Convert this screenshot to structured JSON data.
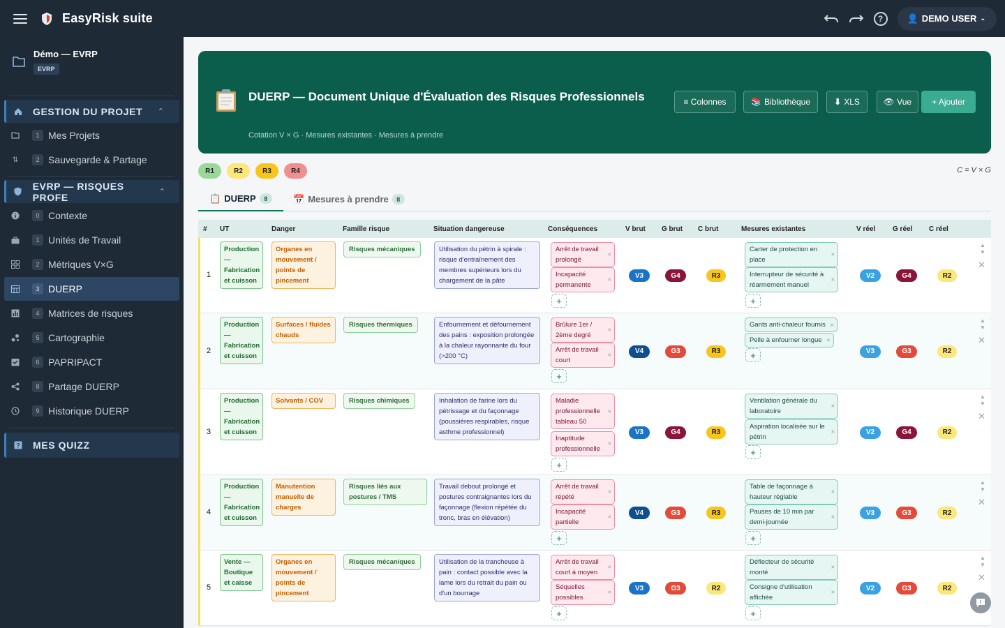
{
  "app": {
    "title": "EasyRisk suite",
    "user": "DEMO USER"
  },
  "sidebar": {
    "project_name": "Démo — EVRP",
    "project_badge": "EVRP",
    "group1": "GESTION DU PROJET",
    "group1_items": [
      {
        "num": "1",
        "label": "Mes Projets",
        "icon": "folder-icon"
      },
      {
        "num": "2",
        "label": "Sauvegarde & Partage",
        "icon": "sort-icon"
      }
    ],
    "group2": "EVRP — RISQUES PROFE",
    "group2_items": [
      {
        "num": "0",
        "label": "Contexte",
        "icon": "info-icon"
      },
      {
        "num": "1",
        "label": "Unités de Travail",
        "icon": "briefcase-icon"
      },
      {
        "num": "2",
        "label": "Métriques V×G",
        "icon": "grid-icon"
      },
      {
        "num": "3",
        "label": "DUERP",
        "icon": "table-icon",
        "active": true
      },
      {
        "num": "4",
        "label": "Matrices de risques",
        "icon": "chart-icon"
      },
      {
        "num": "5",
        "label": "Cartographie",
        "icon": "scatter-icon"
      },
      {
        "num": "6",
        "label": "PAPRIPACT",
        "icon": "checklist-icon"
      },
      {
        "num": "8",
        "label": "Partage DUERP",
        "icon": "share-icon"
      },
      {
        "num": "9",
        "label": "Historique DUERP",
        "icon": "history-icon"
      }
    ],
    "group3": "MES QUIZZ"
  },
  "hero": {
    "title": "DUERP — Document Unique d'Évaluation des Risques Professionnels",
    "subtitle": "Cotation V × G · Mesures existantes · Mesures à prendre",
    "buttons": {
      "columns": "≡ Colonnes",
      "library": "Bibliothèque",
      "xls": "XLS",
      "view": "Vue",
      "add": "+ Ajouter"
    }
  },
  "risk_chips": [
    {
      "label": "R1",
      "color": "#9ad89a"
    },
    {
      "label": "R2",
      "color": "#fbe77a"
    },
    {
      "label": "R3",
      "color": "#f8c61a"
    },
    {
      "label": "R4",
      "color": "#ef8f8f"
    }
  ],
  "formula": "C = V × G",
  "tabs": [
    {
      "label": "DUERP",
      "count": "8"
    },
    {
      "label": "Mesures à prendre",
      "count": "8"
    }
  ],
  "columns": [
    "#",
    "UT",
    "Danger",
    "Famille risque",
    "Situation dangereuse",
    "Conséquences",
    "V brut",
    "G brut",
    "C brut",
    "Mesures existantes",
    "V réel",
    "G réel",
    "C réel"
  ],
  "rows": [
    {
      "n": "1",
      "ut": "Production — Fabrication et cuisson",
      "danger": "Organes en mouvement / points de pincement",
      "family": "Risques mécaniques",
      "situation": "Utilisation du pétrin à spirale : risque d'entraînement des membres supérieurs lors du chargement de la pâte",
      "cons": [
        "Arrêt de travail prolongé",
        "Incapacité permanente"
      ],
      "vb": "V3",
      "gb": "G4",
      "cb": "R3",
      "mes": [
        "Carter de protection en place",
        "Interrupteur de sécurité à réarmement manuel"
      ],
      "vr": "V2",
      "gr": "G4",
      "cr": "R2"
    },
    {
      "n": "2",
      "ut": "Production — Fabrication et cuisson",
      "danger": "Surfaces / fluides chauds",
      "family": "Risques thermiques",
      "situation": "Enfournement et défournement des pains : exposition prolongée à la chaleur rayonnante du four (>200 °C)",
      "cons": [
        "Brûlure 1er / 2ème degré",
        "Arrêt de travail court"
      ],
      "vb": "V4",
      "gb": "G3",
      "cb": "R3",
      "mes": [
        "Gants anti-chaleur fournis",
        "Pelle à enfourner longue"
      ],
      "vr": "V3",
      "gr": "G3",
      "cr": "R2"
    },
    {
      "n": "3",
      "ut": "Production — Fabrication et cuisson",
      "danger": "Solvants / COV",
      "family": "Risques chimiques",
      "situation": "Inhalation de farine lors du pétrissage et du façonnage (poussières respirables, risque asthme professionnel)",
      "cons": [
        "Maladie professionnelle tableau 50",
        "Inaptitude professionnelle"
      ],
      "vb": "V3",
      "gb": "G4",
      "cb": "R3",
      "mes": [
        "Ventilation générale du laboratoire",
        "Aspiration localisée sur le pétrin"
      ],
      "vr": "V2",
      "gr": "G4",
      "cr": "R2"
    },
    {
      "n": "4",
      "ut": "Production — Fabrication et cuisson",
      "danger": "Manutention manuelle de charges",
      "family": "Risques liés aux postures / TMS",
      "situation": "Travail debout prolongé et postures contraignantes lors du façonnage (flexion répétée du tronc, bras en élévation)",
      "cons": [
        "Arrêt de travail répété",
        "Incapacité partielle"
      ],
      "vb": "V4",
      "gb": "G3",
      "cb": "R3",
      "mes": [
        "Table de façonnage à hauteur réglable",
        "Pauses de 10 min par demi-journée"
      ],
      "vr": "V3",
      "gr": "G3",
      "cr": "R2"
    },
    {
      "n": "5",
      "ut": "Vente — Boutique et caisse",
      "danger": "Organes en mouvement / points de pincement",
      "family": "Risques mécaniques",
      "situation": "Utilisation de la trancheuse à pain : contact possible avec la lame lors du retrait du pain ou d'un bourrage",
      "cons": [
        "Arrêt de travail court à moyen",
        "Séquelles possibles"
      ],
      "vb": "V3",
      "gb": "G3",
      "cb": "R2",
      "mes": [
        "Déflecteur de sécurité monté",
        "Consigne d'utilisation affichée"
      ],
      "vr": "V2",
      "gr": "G3",
      "cr": "R2"
    }
  ],
  "colors": {
    "v_dark": "#0d4f8f",
    "v_light": "#3aa2e3",
    "g_dark": "#8a1538",
    "g_light": "#e44a3a",
    "r3": "#f8c61a",
    "r2": "#fbe77a",
    "hero": "#0c5e4c"
  }
}
